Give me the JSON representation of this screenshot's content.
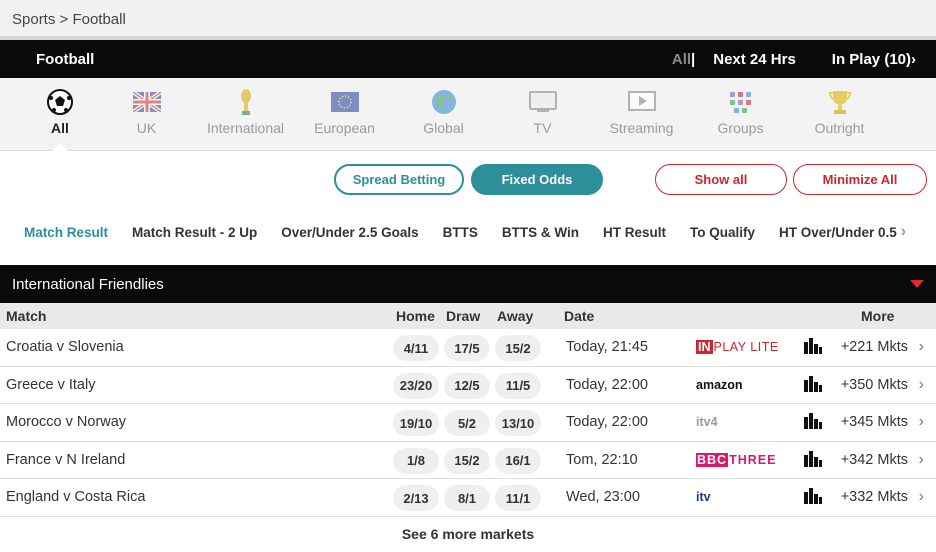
{
  "breadcrumb": "Sports > Football",
  "topbar": {
    "title": "Football",
    "all": "All",
    "separator": "|",
    "next24": "Next 24 Hrs",
    "inplay": "In Play (10)"
  },
  "categories": [
    {
      "label": "All",
      "icon": "football-icon"
    },
    {
      "label": "UK",
      "icon": "uk-flag-icon"
    },
    {
      "label": "International",
      "icon": "trophy-icon"
    },
    {
      "label": "European",
      "icon": "eu-flag-icon"
    },
    {
      "label": "Global",
      "icon": "globe-icon"
    },
    {
      "label": "TV",
      "icon": "tv-icon"
    },
    {
      "label": "Streaming",
      "icon": "play-icon"
    },
    {
      "label": "Groups",
      "icon": "groups-icon"
    },
    {
      "label": "Outright",
      "icon": "cup-icon"
    }
  ],
  "buttons": {
    "spread": "Spread Betting",
    "fixed": "Fixed Odds",
    "show_all": "Show all",
    "minimize_all": "Minimize All"
  },
  "markets": [
    "Match Result",
    "Match Result - 2 Up",
    "Over/Under 2.5 Goals",
    "BTTS",
    "BTTS & Win",
    "HT Result",
    "To Qualify",
    "HT Over/Under 0.5"
  ],
  "section": {
    "title": "International Friendlies"
  },
  "columns": {
    "match": "Match",
    "home": "Home",
    "draw": "Draw",
    "away": "Away",
    "date": "Date",
    "more": "More"
  },
  "matches": [
    {
      "name": "Croatia v Slovenia",
      "home": "4/11",
      "draw": "17/5",
      "away": "15/2",
      "date": "Today, 21:45",
      "tv_a": "IN",
      "tv_b": "PLAY LITE",
      "mkts": "+221 Mkts"
    },
    {
      "name": "Greece v Italy",
      "home": "23/20",
      "draw": "12/5",
      "away": "11/5",
      "date": "Today, 22:00",
      "tv_a": "amazon",
      "tv_b": "",
      "mkts": "+350 Mkts"
    },
    {
      "name": "Morocco v Norway",
      "home": "19/10",
      "draw": "5/2",
      "away": "13/10",
      "date": "Today, 22:00",
      "tv_a": "itv4",
      "tv_b": "",
      "mkts": "+345 Mkts"
    },
    {
      "name": "France v N Ireland",
      "home": "1/8",
      "draw": "15/2",
      "away": "16/1",
      "date": "Tom, 22:10",
      "tv_a": "BBC",
      "tv_b": "THREE",
      "mkts": "+342 Mkts"
    },
    {
      "name": "England v Costa Rica",
      "home": "2/13",
      "draw": "8/1",
      "away": "11/1",
      "date": "Wed, 23:00",
      "tv_a": "itv",
      "tv_b": "",
      "mkts": "+332 Mkts"
    }
  ],
  "see_more": "See 6 more markets",
  "colors": {
    "accent": "#2d8f99",
    "red": "#c8282e",
    "dark": "#0a0a0a"
  }
}
